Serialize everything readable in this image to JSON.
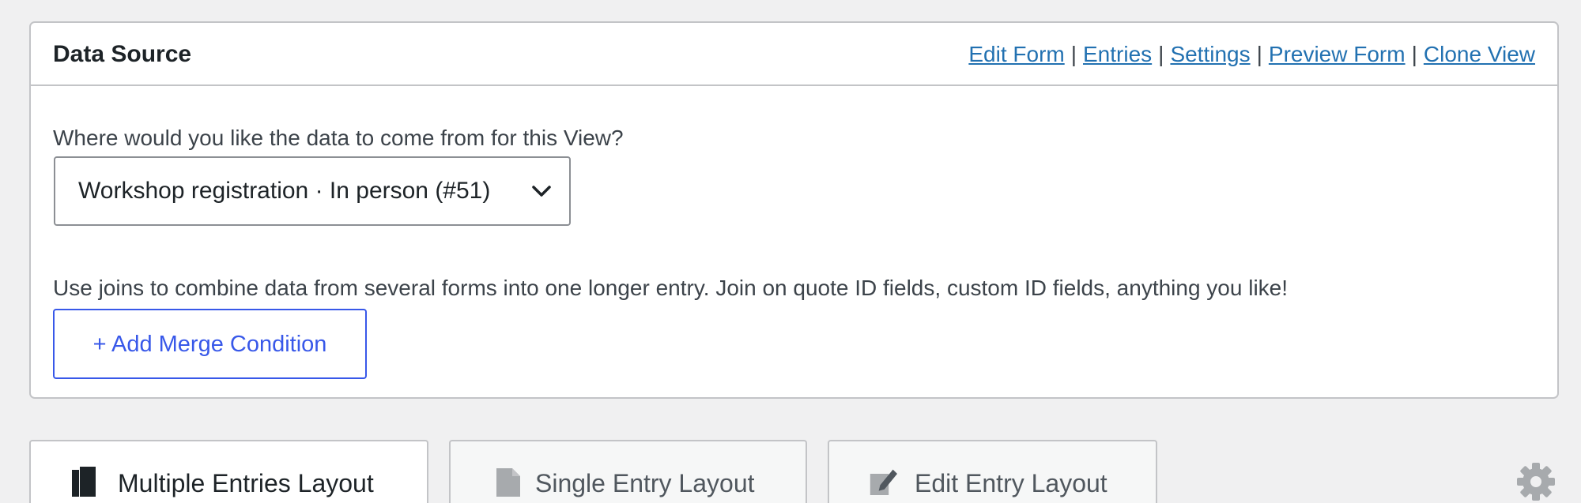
{
  "panel": {
    "title": "Data Source",
    "links": [
      {
        "label": "Edit Form"
      },
      {
        "label": "Entries"
      },
      {
        "label": "Settings"
      },
      {
        "label": "Preview Form"
      },
      {
        "label": "Clone View"
      }
    ],
    "separator": "|",
    "question": "Where would you like the data to come from for this View?",
    "form_select": {
      "value": "Workshop registration · In person (#51)"
    },
    "help_text": "Use joins to combine data from several forms into one longer entry. Join on quote ID fields, custom ID fields, anything you like!",
    "add_button_label": "+ Add Merge Condition"
  },
  "tabs": [
    {
      "label": "Multiple Entries Layout",
      "icon": "directory-icon",
      "active": true
    },
    {
      "label": "Single Entry Layout",
      "icon": "document-icon",
      "active": false
    },
    {
      "label": "Edit Entry Layout",
      "icon": "edit-icon",
      "active": false
    }
  ],
  "settings_icon": "gear-icon",
  "colors": {
    "link": "#2271b1",
    "button_accent": "#3858e9",
    "border": "#c3c4c7",
    "background": "#f0f0f1",
    "icon_grey": "#50575e"
  }
}
